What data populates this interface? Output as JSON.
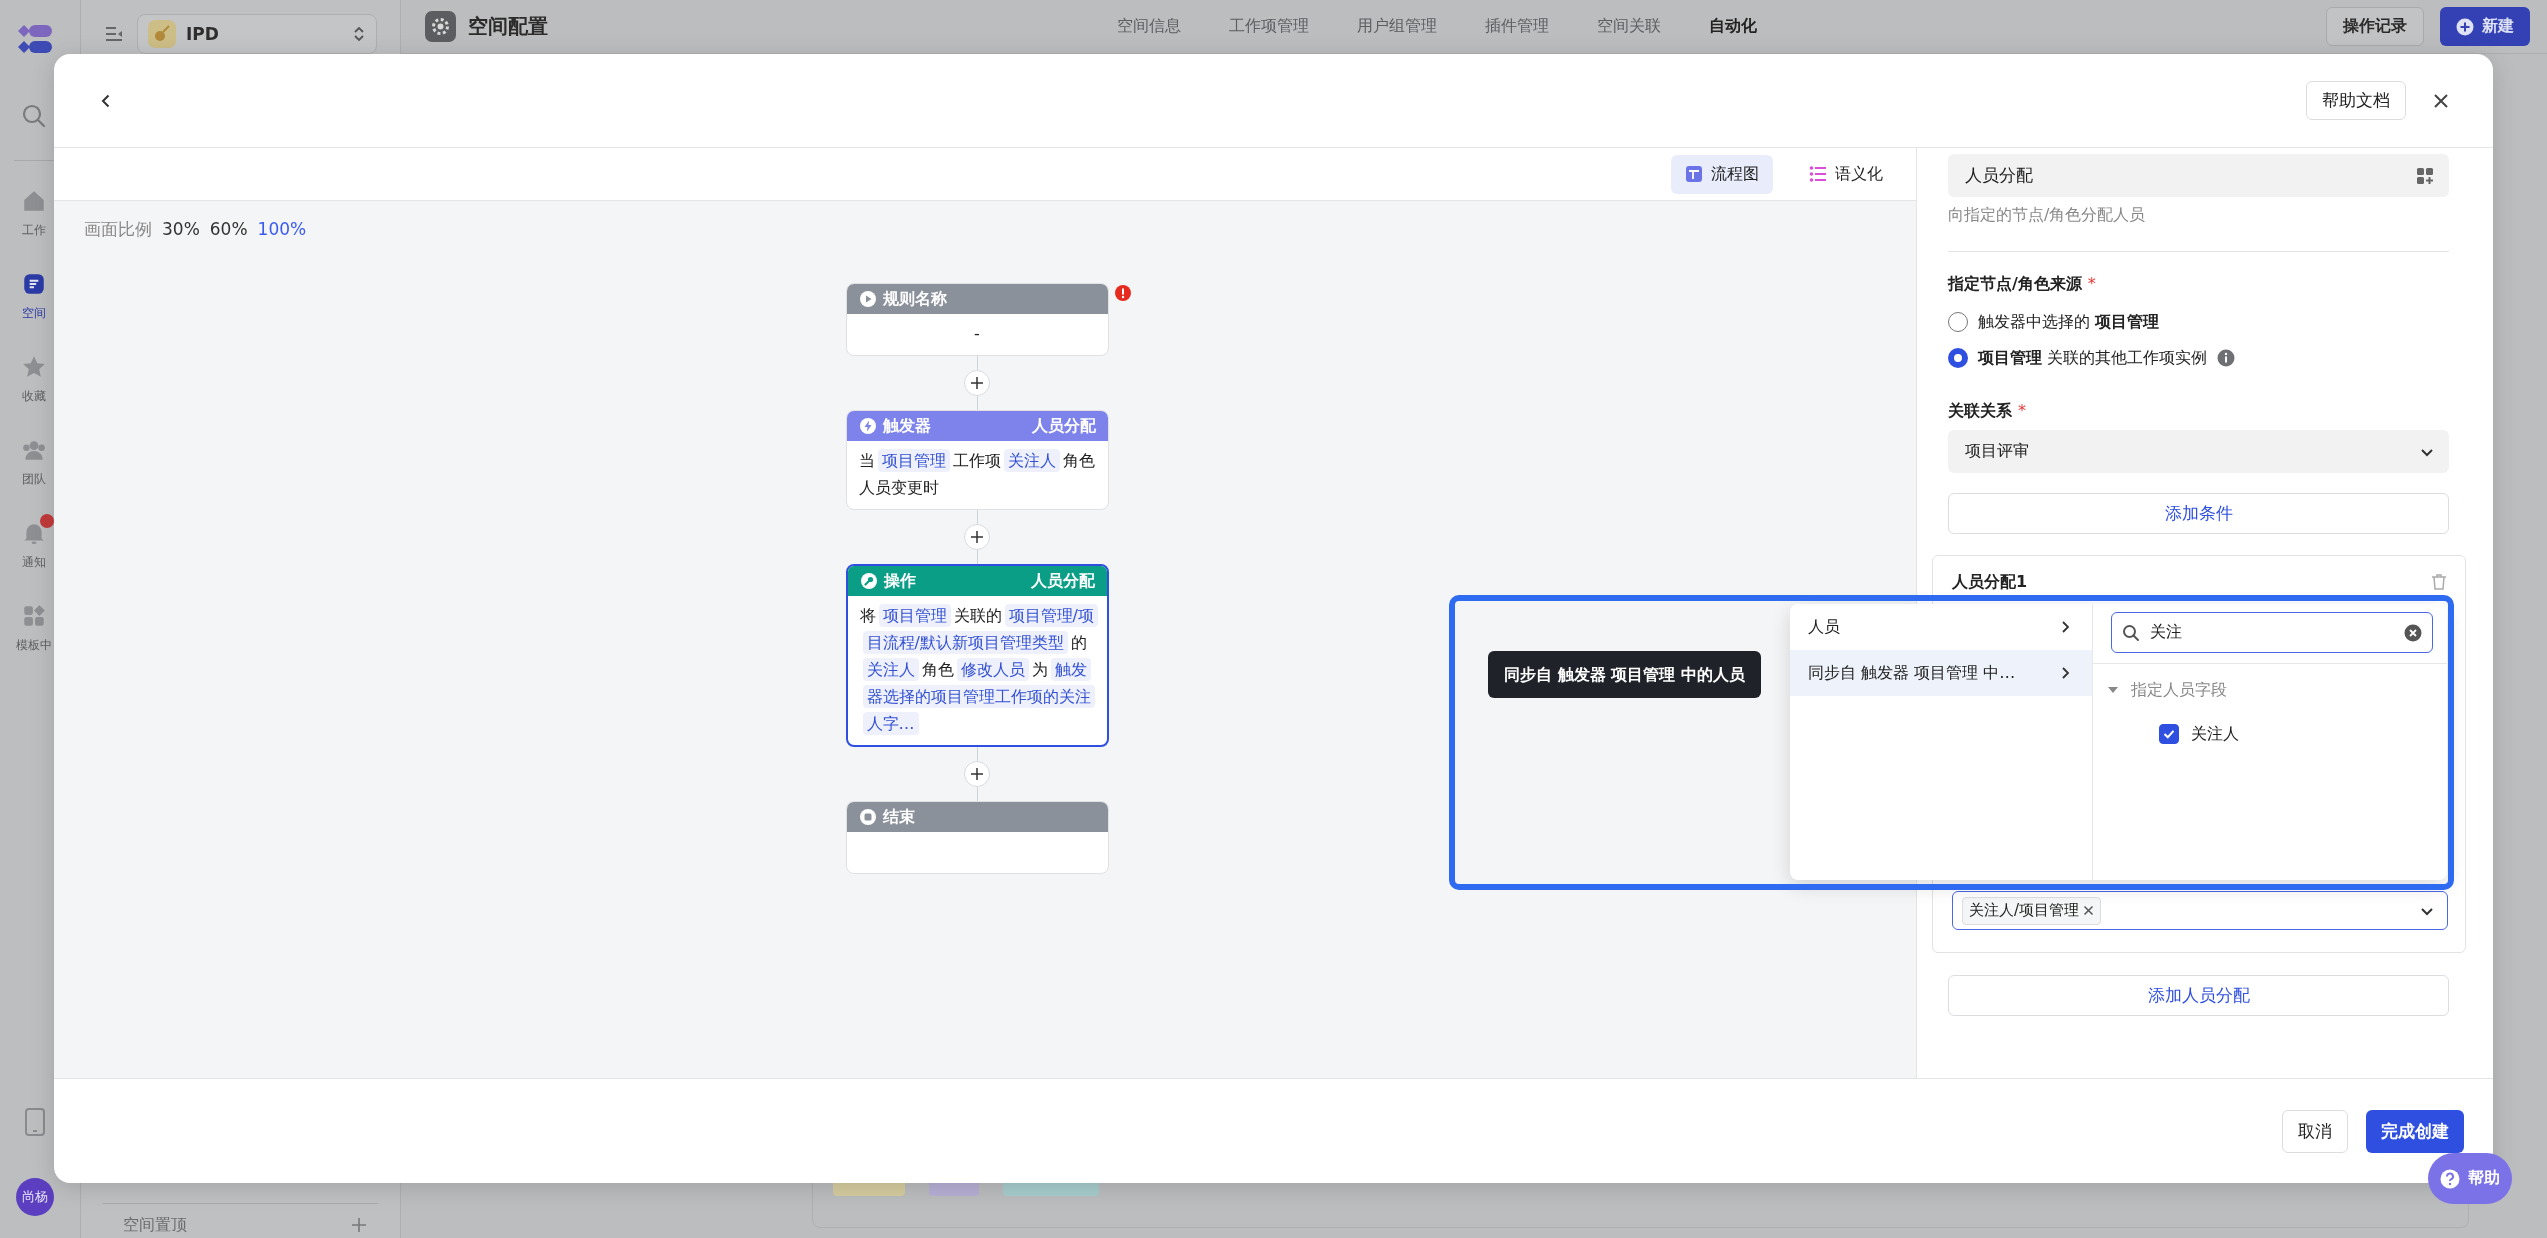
{
  "rail": {
    "items": [
      {
        "label": "工作",
        "selected": false,
        "badge": false
      },
      {
        "label": "空间",
        "selected": true,
        "badge": false
      },
      {
        "label": "收藏",
        "selected": false,
        "badge": false
      },
      {
        "label": "团队",
        "selected": false,
        "badge": false
      },
      {
        "label": "通知",
        "selected": false,
        "badge": true
      },
      {
        "label": "模板中",
        "selected": false,
        "badge": false
      }
    ],
    "avatar": "尚杨"
  },
  "sidebar": {
    "workspace": "IPD",
    "pinned_heading": "空间置顶"
  },
  "top_bar": {
    "title": "空间配置",
    "tabs": [
      {
        "label": "空间信息",
        "selected": false
      },
      {
        "label": "工作项管理",
        "selected": false
      },
      {
        "label": "用户组管理",
        "selected": false
      },
      {
        "label": "插件管理",
        "selected": false
      },
      {
        "label": "空间关联",
        "selected": false
      },
      {
        "label": "自动化",
        "selected": true
      }
    ],
    "buttons": [
      {
        "label": "操作记录",
        "kind": "secondary"
      },
      {
        "label": "新建",
        "kind": "primary"
      }
    ]
  },
  "modal": {
    "help_button": "帮助文档",
    "view_tabs": [
      {
        "label": "流程图",
        "selected": true
      },
      {
        "label": "语义化",
        "selected": false
      }
    ],
    "zoom": {
      "label": "画面比例",
      "options": [
        {
          "label": "30%",
          "selected": false
        },
        {
          "label": "60%",
          "selected": false
        },
        {
          "label": "100%",
          "selected": true
        }
      ]
    },
    "flow": {
      "nodes": [
        {
          "kind": "start",
          "title": "规则名称",
          "error": true,
          "selected": false,
          "segments": [
            {
              "kind": "text",
              "text": "-"
            }
          ]
        },
        {
          "kind": "trigger",
          "title": "触发器",
          "type": "人员分配",
          "error": false,
          "selected": false,
          "segments": [
            {
              "kind": "text",
              "text": "当"
            },
            {
              "kind": "tag",
              "text": "项目管理"
            },
            {
              "kind": "text",
              "text": "工作项"
            },
            {
              "kind": "tag",
              "text": "关注人"
            },
            {
              "kind": "text",
              "text": "角色人员变更时"
            }
          ]
        },
        {
          "kind": "action",
          "title": "操作",
          "type": "人员分配",
          "error": false,
          "selected": true,
          "segments": [
            {
              "kind": "text",
              "text": "将"
            },
            {
              "kind": "tag",
              "text": "项目管理"
            },
            {
              "kind": "text",
              "text": "关联的"
            },
            {
              "kind": "tag",
              "text": "项目管理/项目流程/默认新项目管理类型"
            },
            {
              "kind": "text",
              "text": "的"
            },
            {
              "kind": "tag",
              "text": "关注人"
            },
            {
              "kind": "text",
              "text": "角色"
            },
            {
              "kind": "tag",
              "text": "修改人员"
            },
            {
              "kind": "text",
              "text": "为"
            },
            {
              "kind": "tag",
              "text": "触发器选择的项目管理工作项的关注人字…"
            }
          ]
        },
        {
          "kind": "end",
          "title": "结束",
          "error": false,
          "selected": false
        }
      ]
    },
    "panel": {
      "action_field": "人员分配",
      "description": "向指定的节点/角色分配人员",
      "source": {
        "label": "指定节点/角色来源",
        "required_mark": "*",
        "options": [
          {
            "text": "触发器中选择的 **项目管理**",
            "selected": false,
            "info": false
          },
          {
            "text": "**项目管理** 关联的其他工作项实例",
            "selected": true,
            "info": true
          }
        ]
      },
      "relation": {
        "label": "关联关系",
        "required_mark": "*",
        "value": "项目评审"
      },
      "add_condition": "添加条件",
      "assignment_card": {
        "title": "人员分配1",
        "tags": [
          "关注人/项目管理"
        ]
      },
      "add_assignment": "添加人员分配"
    },
    "cascader": {
      "items": [
        {
          "label": "人员",
          "selected": false,
          "expandable": true
        },
        {
          "label": "同步自 触发器 项目管理 中…",
          "selected": true,
          "expandable": true
        }
      ],
      "search": {
        "value": "关注"
      },
      "groups": [
        {
          "label": "指定人员字段",
          "expanded": true,
          "options": [
            {
              "label": "关注人",
              "checked": true
            }
          ]
        }
      ]
    },
    "tooltip": "同步自 触发器 项目管理 中的人员",
    "footer_buttons": [
      {
        "label": "取消",
        "kind": "secondary"
      },
      {
        "label": "完成创建",
        "kind": "primary"
      }
    ]
  },
  "help_fab": "帮助"
}
